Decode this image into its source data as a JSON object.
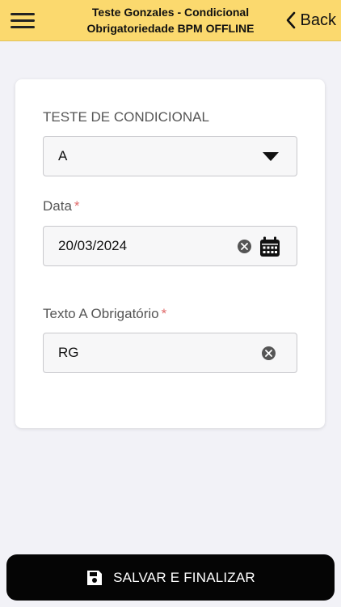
{
  "header": {
    "title_line1": "Teste Gonzales - Condicional",
    "title_line2": "Obrigatoriedade BPM OFFLINE",
    "back_label": "Back",
    "menu_icon": "hamburger-icon",
    "back_icon": "chevron-left-icon",
    "background": "#fbd96e"
  },
  "form": {
    "condicional": {
      "label": "TESTE DE CONDICIONAL",
      "value": "A",
      "icon": "caret-down-icon"
    },
    "data": {
      "label": "Data",
      "required_mark": "*",
      "value": "20/03/2024",
      "clear_icon": "clear-icon",
      "calendar_icon": "calendar-icon"
    },
    "texto_a": {
      "label": "Texto A Obrigatório",
      "required_mark": "*",
      "value": "RG",
      "clear_icon": "clear-icon"
    }
  },
  "footer": {
    "save_label": "SALVAR E FINALIZAR",
    "save_icon": "floppy-disk-icon",
    "background": "#050505"
  }
}
